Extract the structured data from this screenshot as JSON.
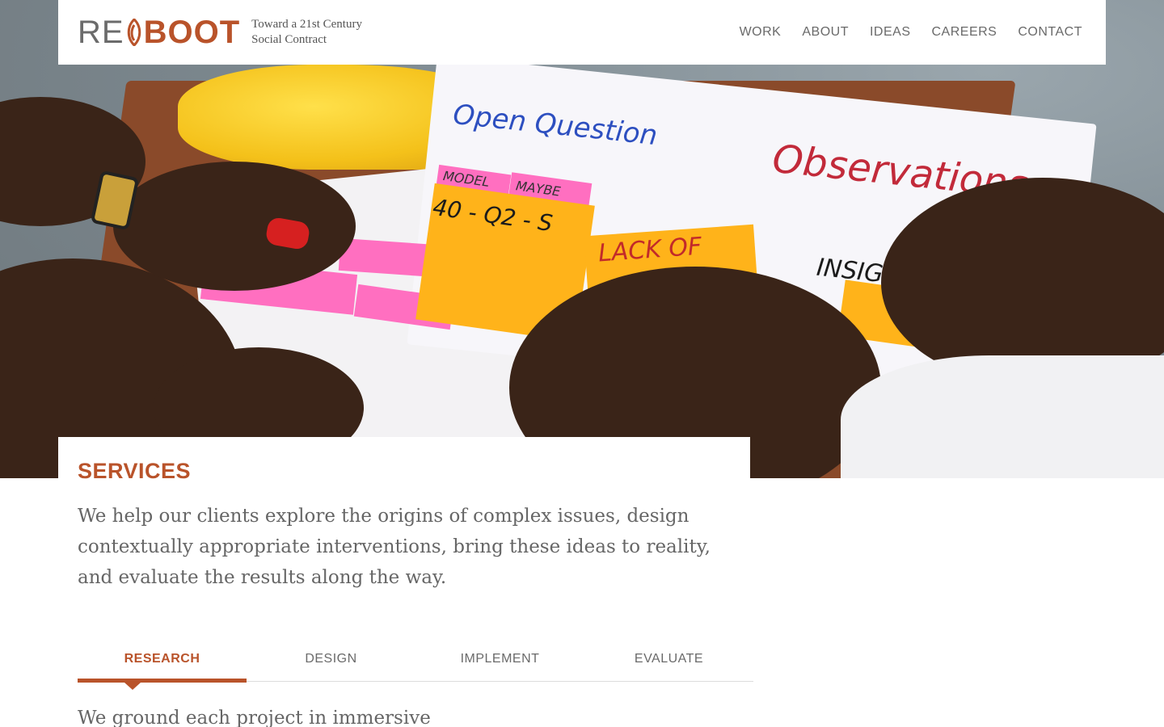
{
  "brand": {
    "logo_re": "RE",
    "logo_boot": "BOOT",
    "tagline_line1": "Toward a 21st Century",
    "tagline_line2": "Social Contract"
  },
  "nav": {
    "items": [
      {
        "label": "WORK"
      },
      {
        "label": "ABOUT"
      },
      {
        "label": "IDEAS"
      },
      {
        "label": "CAREERS"
      },
      {
        "label": "CONTACT"
      }
    ]
  },
  "hero": {
    "handwriting": {
      "open_question": "Open Question",
      "observations": "Observations",
      "lack_of": "LACK OF",
      "model": "MODEL",
      "maybe": "MAYBE",
      "note_code": "40 - Q2 - S",
      "insight": "INSIGHT"
    }
  },
  "services": {
    "title": "SERVICES",
    "intro": "We help our clients explore the origins of complex issues, design contextually appropriate interventions, bring these ideas to reality, and evaluate the results along the way.",
    "tabs": [
      {
        "label": "RESEARCH"
      },
      {
        "label": "DESIGN"
      },
      {
        "label": "IMPLEMENT"
      },
      {
        "label": "EVALUATE"
      }
    ],
    "active_tab": "RESEARCH",
    "body": "We ground each project in immersive"
  },
  "colors": {
    "accent": "#b9532a",
    "text": "#666666",
    "nav_text": "#6a6a6a"
  }
}
